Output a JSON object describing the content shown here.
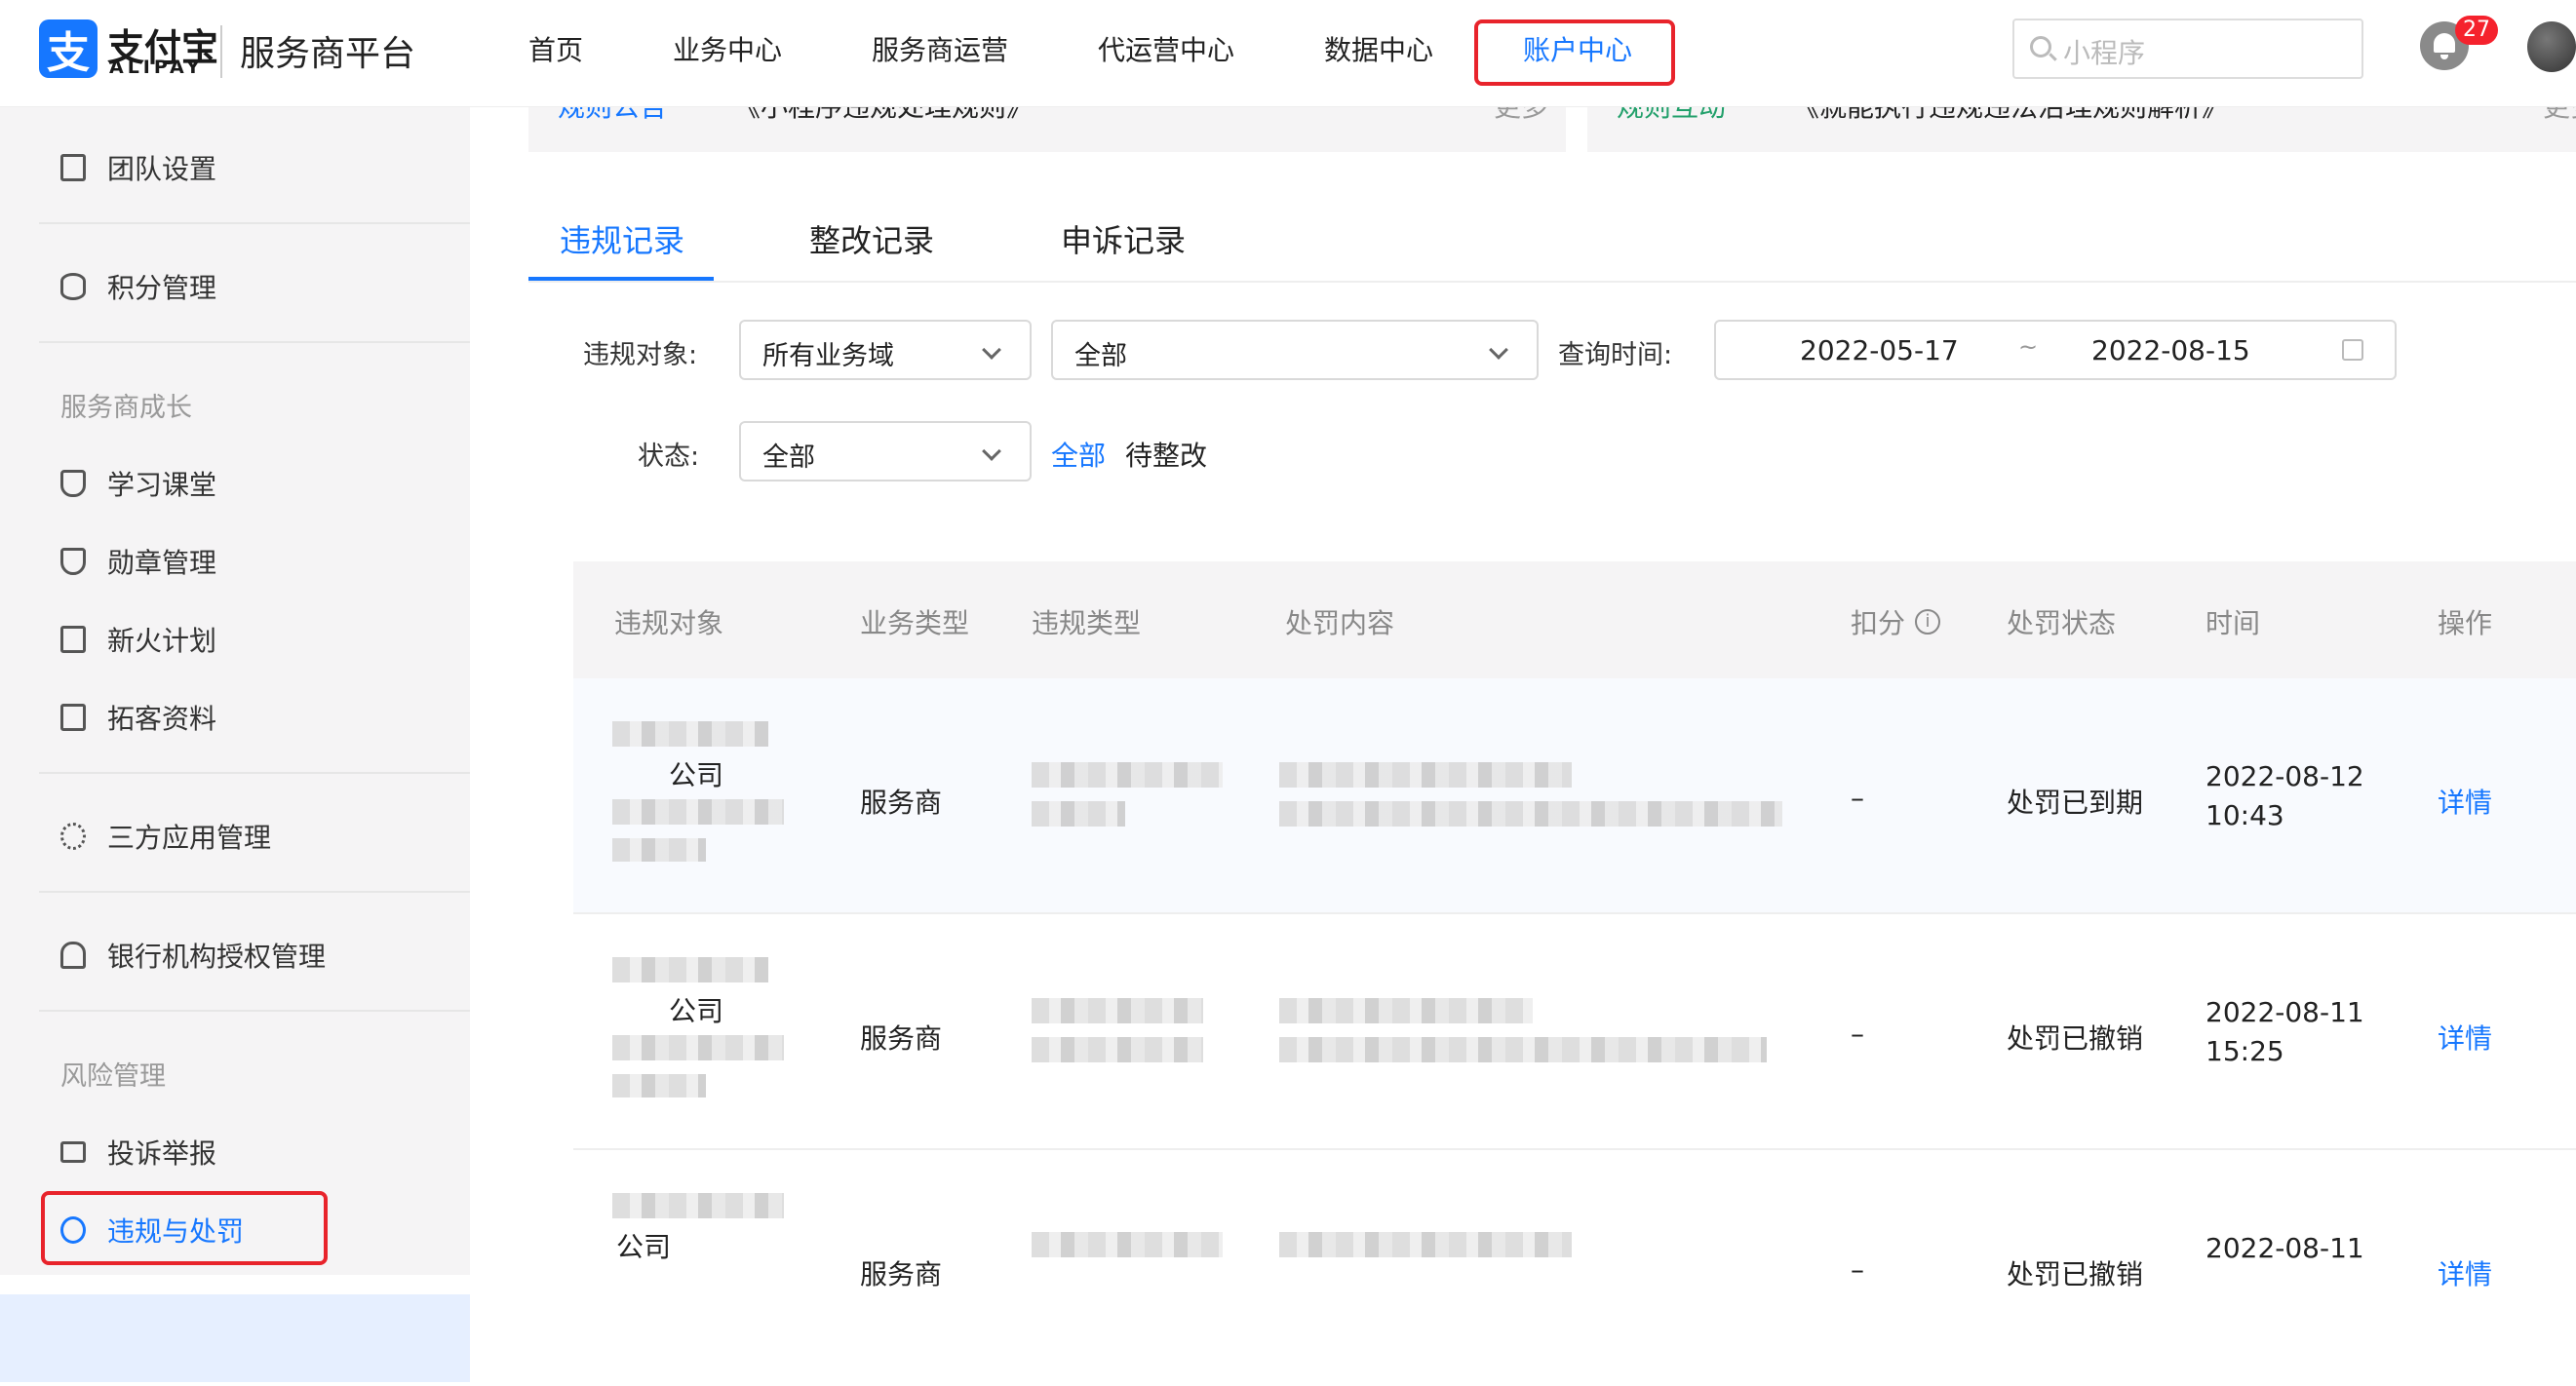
{
  "header": {
    "logo_cn": "支付宝",
    "logo_en": "ALIPAY",
    "platform": "服务商平台",
    "nav": [
      "首页",
      "业务中心",
      "服务商运营",
      "代运营中心",
      "数据中心",
      "账户中心"
    ],
    "search_placeholder": "小程序",
    "notification_count": "27"
  },
  "sidebar": {
    "items_top": [
      "团队设置",
      "积分管理"
    ],
    "section_growth": "服务商成长",
    "growth_items": [
      "学习课堂",
      "勋章管理",
      "新火计划",
      "拓客资料"
    ],
    "item_apps": "三方应用管理",
    "item_bank": "银行机构授权管理",
    "section_risk": "风险管理",
    "risk_items": [
      "投诉举报",
      "违规与处罚"
    ]
  },
  "notices": {
    "left_tag": "规则公告",
    "left_text": "《小程序违规处理规则》",
    "left_more": "更多",
    "right_tag": "规则互动",
    "right_text": "《就能执行违规违法治理规则解析》",
    "right_more": "更多"
  },
  "tabs": [
    "违规记录",
    "整改记录",
    "申诉记录"
  ],
  "filters": {
    "target_label": "违规对象:",
    "target_value": "所有业务域",
    "scope_value": "全部",
    "time_label": "查询时间:",
    "date_start": "2022-05-17",
    "date_sep": "~",
    "date_end": "2022-08-15",
    "status_label": "状态:",
    "status_value": "全部",
    "quick_all": "全部",
    "quick_pending": "待整改"
  },
  "table": {
    "columns": [
      "违规对象",
      "业务类型",
      "违规类型",
      "处罚内容",
      "扣分",
      "处罚状态",
      "时间",
      "操作"
    ],
    "rows": [
      {
        "target": "公司",
        "biz": "服务商",
        "score": "–",
        "status": "处罚已到期",
        "date": "2022-08-12",
        "time": "10:43",
        "action": "详情"
      },
      {
        "target": "公司",
        "biz": "服务商",
        "score": "–",
        "status": "处罚已撤销",
        "date": "2022-08-11",
        "time": "15:25",
        "action": "详情"
      },
      {
        "target": "公司",
        "biz": "服务商",
        "score": "–",
        "status": "处罚已撤销",
        "date": "2022-08-11",
        "time": "",
        "action": "详情"
      }
    ]
  }
}
